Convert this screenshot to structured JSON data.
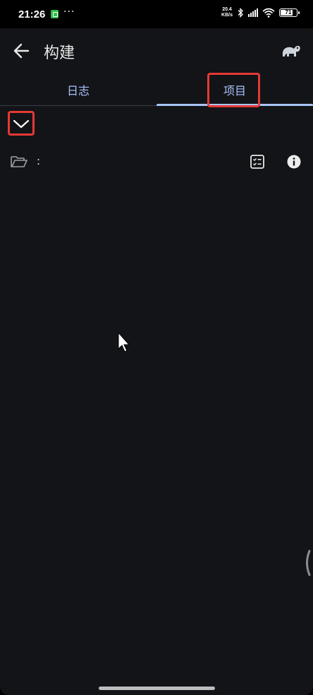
{
  "status_bar": {
    "time": "21:26",
    "net_speed_top": "20.4",
    "net_speed_bottom": "KB/s",
    "battery": "71",
    "notification_dots": "···",
    "icons": [
      "shield-icon",
      "bluetooth-icon",
      "signal-icon",
      "wifi-icon",
      "battery-icon"
    ]
  },
  "app_bar": {
    "title": "构建",
    "back_icon": "arrow-left-icon",
    "logo_icon": "elephant-icon"
  },
  "tabs": [
    {
      "label": "日志",
      "selected": false
    },
    {
      "label": "项目",
      "selected": true
    }
  ],
  "project": {
    "path": ":",
    "folder_icon": "folder-open-icon",
    "tasks_icon": "checklist-icon",
    "info_icon": "info-icon"
  },
  "expand_icon": "chevron-down-icon",
  "colors": {
    "background": "#131417",
    "accent": "#a9c4ff",
    "highlight": "#e53935",
    "text": "#e8e8e8"
  }
}
